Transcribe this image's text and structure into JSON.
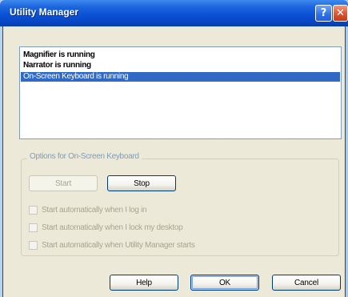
{
  "window": {
    "title": "Utility Manager",
    "help_glyph": "?",
    "close_glyph": "✕"
  },
  "list": {
    "items": [
      {
        "label": "Magnifier is running",
        "selected": false
      },
      {
        "label": "Narrator is running",
        "selected": false
      },
      {
        "label": "On-Screen Keyboard is running",
        "selected": true
      }
    ]
  },
  "options": {
    "group_label": "Options for On-Screen Keyboard",
    "start_label": "Start",
    "stop_label": "Stop",
    "checkboxes": [
      {
        "label": "Start automatically when I log in",
        "checked": false
      },
      {
        "label": "Start automatically when I lock my desktop",
        "checked": false
      },
      {
        "label": "Start automatically when Utility Manager starts",
        "checked": false
      }
    ]
  },
  "footer": {
    "help_label": "Help",
    "ok_label": "OK",
    "cancel_label": "Cancel"
  },
  "colors": {
    "titlebar": "#0a52d6",
    "selection": "#316ac5",
    "dialog_bg": "#ece9d8",
    "disabled_text": "#a7a691"
  },
  "icons": {
    "help": "help-icon",
    "close": "close-icon"
  }
}
